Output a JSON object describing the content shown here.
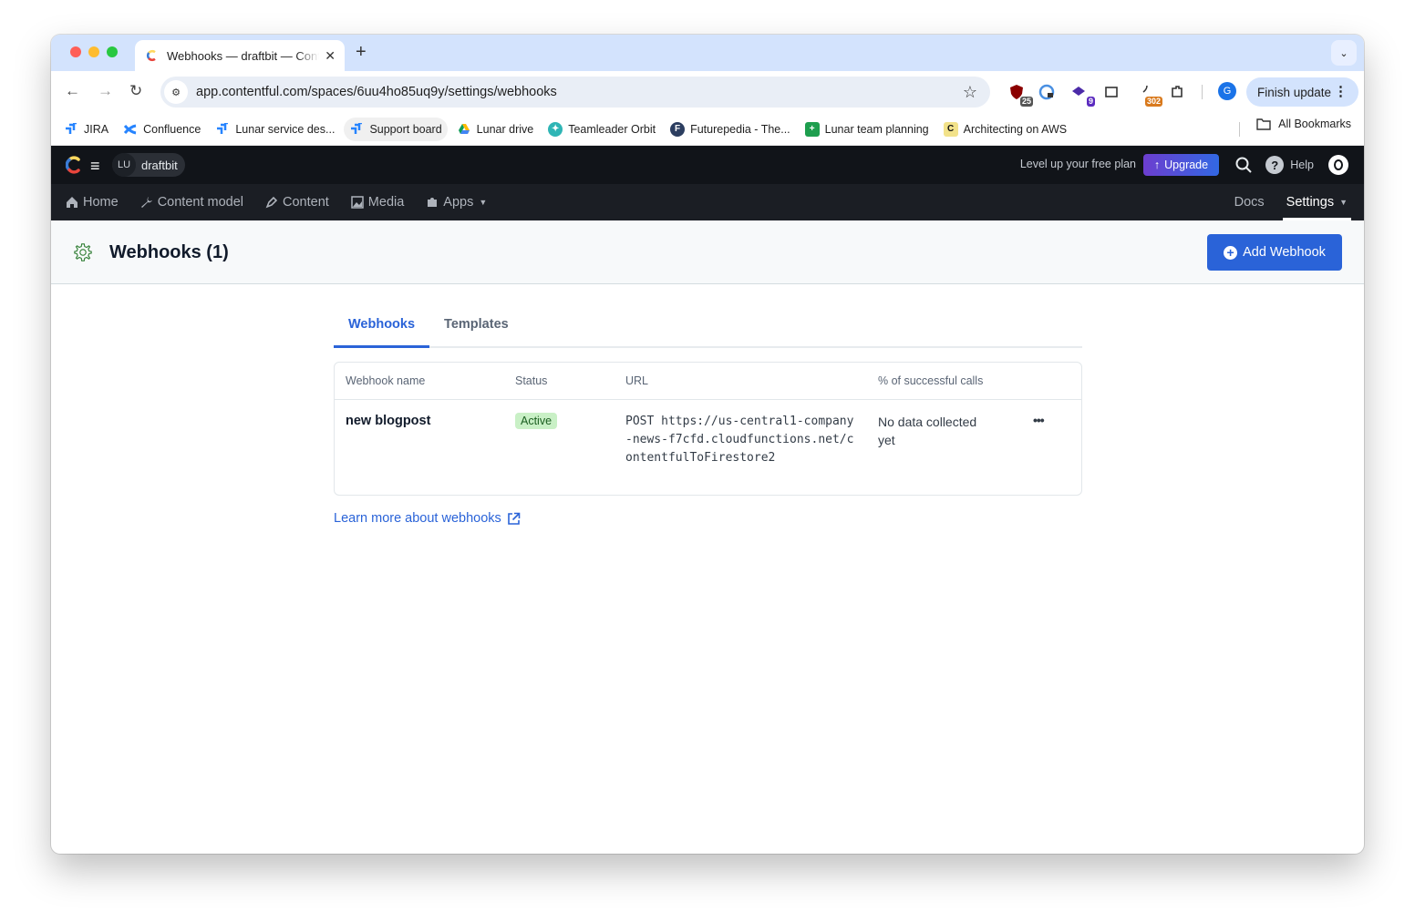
{
  "browser": {
    "tab_title": "Webhooks — draftbit — Contentful",
    "new_tab_icon": "plus-icon",
    "url": "app.contentful.com/spaces/6uu4ho85uq9y/settings/webhooks",
    "extensions": [
      {
        "name": "ublock-extension",
        "badge": "25",
        "badge_color": "#555555"
      },
      {
        "name": "password-extension",
        "badge": "",
        "badge_color": ""
      },
      {
        "name": "stack-extension",
        "badge": "9",
        "badge_color": "#5b2bbf"
      },
      {
        "name": "screenshot-extension",
        "badge": "",
        "badge_color": ""
      },
      {
        "name": "counter-extension",
        "badge": "302",
        "badge_color": "#d97a1e"
      },
      {
        "name": "puzzle-extension",
        "badge": "",
        "badge_color": ""
      }
    ],
    "profile_initial": "G",
    "finish_update": "Finish update",
    "bookmarks": [
      {
        "label": "JIRA",
        "icon": "jira-icon"
      },
      {
        "label": "Confluence",
        "icon": "confluence-icon"
      },
      {
        "label": "Lunar service des...",
        "icon": "jira-icon"
      },
      {
        "label": "Support board",
        "icon": "jira-icon"
      },
      {
        "label": "Lunar drive",
        "icon": "google-drive-icon"
      },
      {
        "label": "Teamleader Orbit",
        "icon": "teamleader-icon"
      },
      {
        "label": "Futurepedia - The...",
        "icon": "futurepedia-icon"
      },
      {
        "label": "Lunar team planning",
        "icon": "sheets-icon"
      },
      {
        "label": "Architecting on AWS",
        "icon": "course-icon"
      }
    ],
    "all_bookmarks": "All Bookmarks"
  },
  "app": {
    "space_avatar": "LU",
    "space_name": "draftbit",
    "level_up": "Level up your free plan",
    "upgrade": "Upgrade",
    "help": "Help",
    "nav": [
      {
        "label": "Home",
        "icon": "home-icon"
      },
      {
        "label": "Content model",
        "icon": "wrench-icon"
      },
      {
        "label": "Content",
        "icon": "pen-icon"
      },
      {
        "label": "Media",
        "icon": "image-icon"
      },
      {
        "label": "Apps",
        "icon": "puzzle-icon"
      }
    ],
    "docs": "Docs",
    "settings": "Settings"
  },
  "page": {
    "title": "Webhooks (1)",
    "add_button": "Add Webhook",
    "tabs": [
      {
        "label": "Webhooks",
        "active": true
      },
      {
        "label": "Templates",
        "active": false
      }
    ],
    "table": {
      "headers": [
        "Webhook name",
        "Status",
        "URL",
        "% of successful calls"
      ],
      "rows": [
        {
          "name": "new blogpost",
          "status": "Active",
          "url": "POST https://us-central1-company-news-f7cfd.cloudfunctions.net/contentfulToFirestore2",
          "calls": "No data collected yet"
        }
      ]
    },
    "learn_more": "Learn more about webhooks"
  },
  "colors": {
    "primary": "#2a63d8",
    "active_badge_bg": "#c9f0c6",
    "active_badge_text": "#1b5e20",
    "nav_bg": "#111419"
  }
}
